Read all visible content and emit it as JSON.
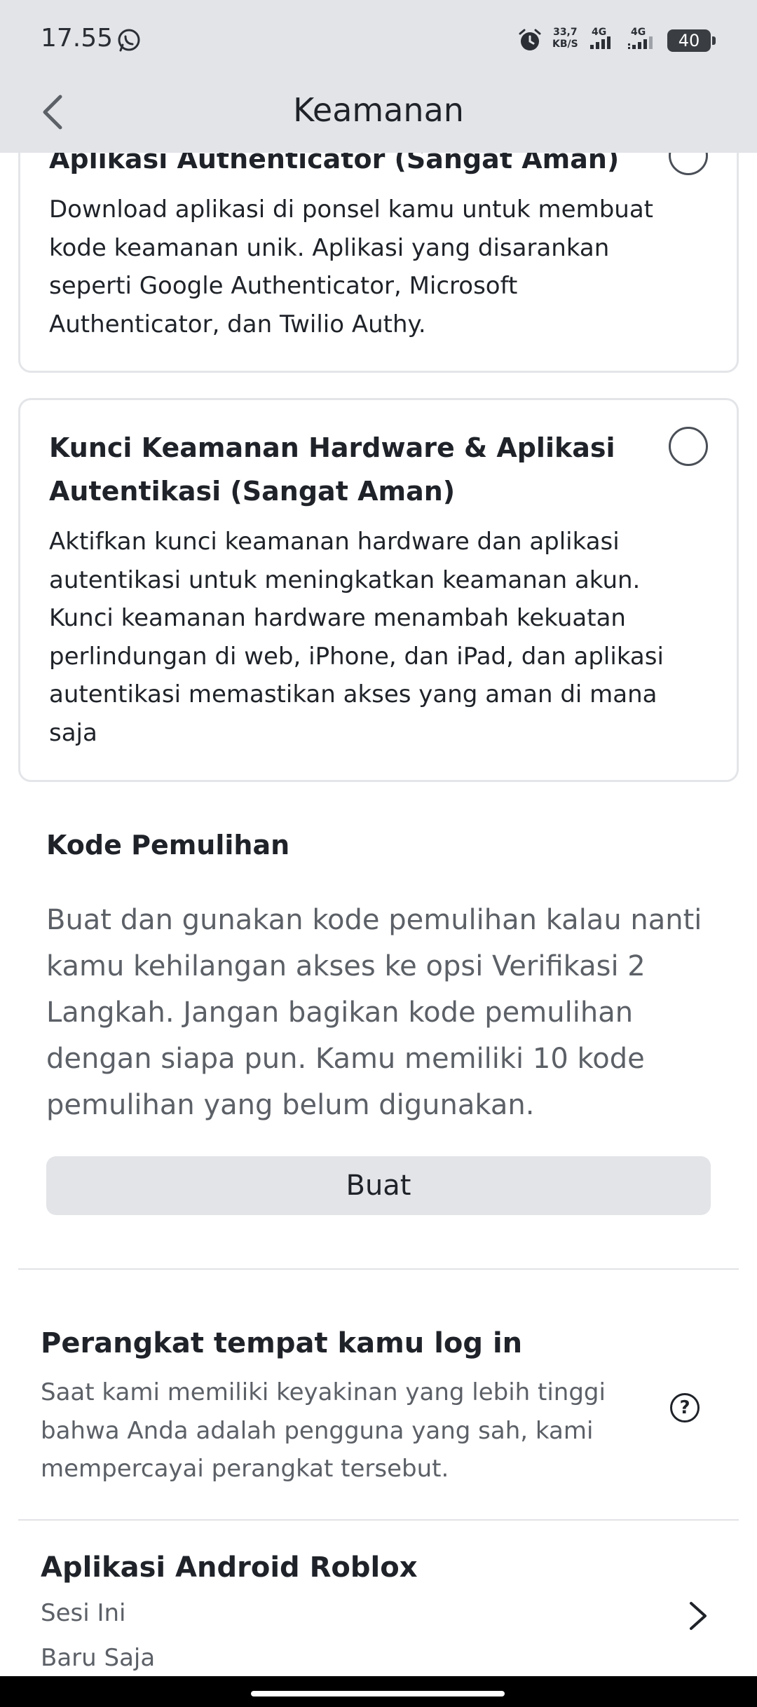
{
  "status_bar": {
    "time": "17.55",
    "speed_value": "33,7",
    "speed_unit": "KB/S",
    "network_1": "4G",
    "network_2": "4G",
    "battery": "40"
  },
  "header": {
    "title": "Keamanan"
  },
  "security_options": [
    {
      "title": "Aplikasi Authenticator (Sangat Aman)",
      "description": "Download aplikasi di ponsel kamu untuk membuat kode keamanan unik. Aplikasi yang disarankan seperti Google Authenticator, Microsoft Authenticator, dan Twilio Authy."
    },
    {
      "title": "Kunci Keamanan Hardware & Aplikasi Autentikasi (Sangat Aman)",
      "description": "Aktifkan kunci keamanan hardware dan aplikasi autentikasi untuk meningkatkan keamanan akun. Kunci keamanan hardware menambah kekuatan perlindungan di web, iPhone, dan iPad, dan aplikasi autentikasi memastikan akses yang aman di mana saja"
    }
  ],
  "recovery": {
    "title": "Kode Pemulihan",
    "description": "Buat dan gunakan kode pemulihan kalau nanti kamu kehilangan akses ke opsi Verifikasi 2 Langkah. Jangan bagikan kode pemulihan dengan siapa pun. Kamu memiliki 10 kode pemulihan yang belum digunakan.",
    "button_label": "Buat"
  },
  "devices": {
    "title": "Perangkat tempat kamu log in",
    "description": "Saat kami memiliki keyakinan yang lebih tinggi bahwa Anda adalah pengguna yang sah, kami mempercayai perangkat tersebut.",
    "help_symbol": "?",
    "items": [
      {
        "name": "Aplikasi Android Roblox",
        "session": "Sesi Ini",
        "last_active": "Baru Saja"
      }
    ]
  },
  "colors": {
    "header_bg": "#e2e4e8",
    "button_bg": "#e3e4e8",
    "card_border": "#e3e5e8",
    "text_primary": "#1f2329",
    "text_secondary": "#5c6067"
  }
}
